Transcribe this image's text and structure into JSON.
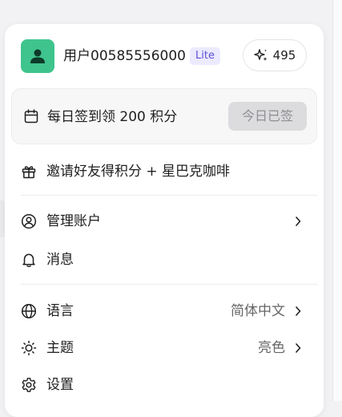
{
  "user": {
    "name": "用户00585556000",
    "plan": "Lite",
    "points": "495",
    "avatar_color": "#3fc48d"
  },
  "checkin": {
    "text": "每日签到领 200 积分",
    "button_label": "今日已签"
  },
  "menu": {
    "invite": {
      "label": "邀请好友得积分 + 星巴克咖啡"
    },
    "account": {
      "label": "管理账户"
    },
    "messages": {
      "label": "消息"
    },
    "language": {
      "label": "语言",
      "value": "简体中文"
    },
    "theme": {
      "label": "主题",
      "value": "亮色"
    },
    "settings": {
      "label": "设置"
    }
  },
  "icons": {
    "checkin": "calendar-icon",
    "invite": "gift-icon",
    "account": "user-circle-icon",
    "messages": "bell-icon",
    "language": "globe-icon",
    "theme": "sun-icon",
    "settings": "gear-icon",
    "points": "sparkle-icon"
  }
}
